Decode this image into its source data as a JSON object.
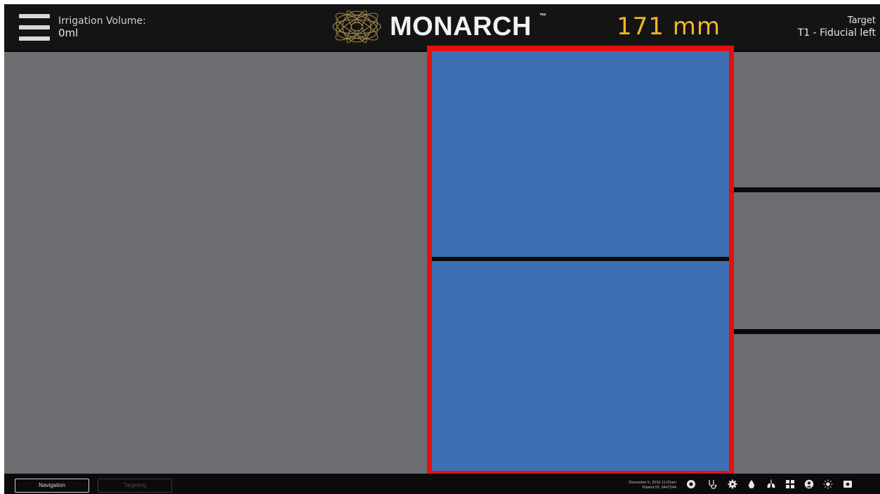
{
  "header": {
    "irrigation_label": "Irrigation Volume:",
    "irrigation_value": "0ml",
    "brand": "MONARCH",
    "trademark": "™",
    "distance": "171 mm",
    "target_label": "Target",
    "target_value": "T1 - Fiducial left",
    "accent_color": "#f0b62a"
  },
  "views": {
    "highlight_color": "#e60f0f",
    "view_color": "#3d6fb4",
    "panel_color": "#6c6d70"
  },
  "bottom_bar": {
    "tabs": [
      {
        "label": "Navigation",
        "active": true
      },
      {
        "label": "Targeting",
        "active": false
      }
    ],
    "date": "December 5, 2016 11:03am",
    "patient": "Patient ID: 3447544",
    "icons": [
      "camera-icon",
      "stethoscope-icon",
      "gear-icon",
      "water-drop-icon",
      "lungs-icon",
      "grid-layout-icon",
      "user-icon",
      "brightness-icon",
      "screenshot-icon"
    ]
  }
}
